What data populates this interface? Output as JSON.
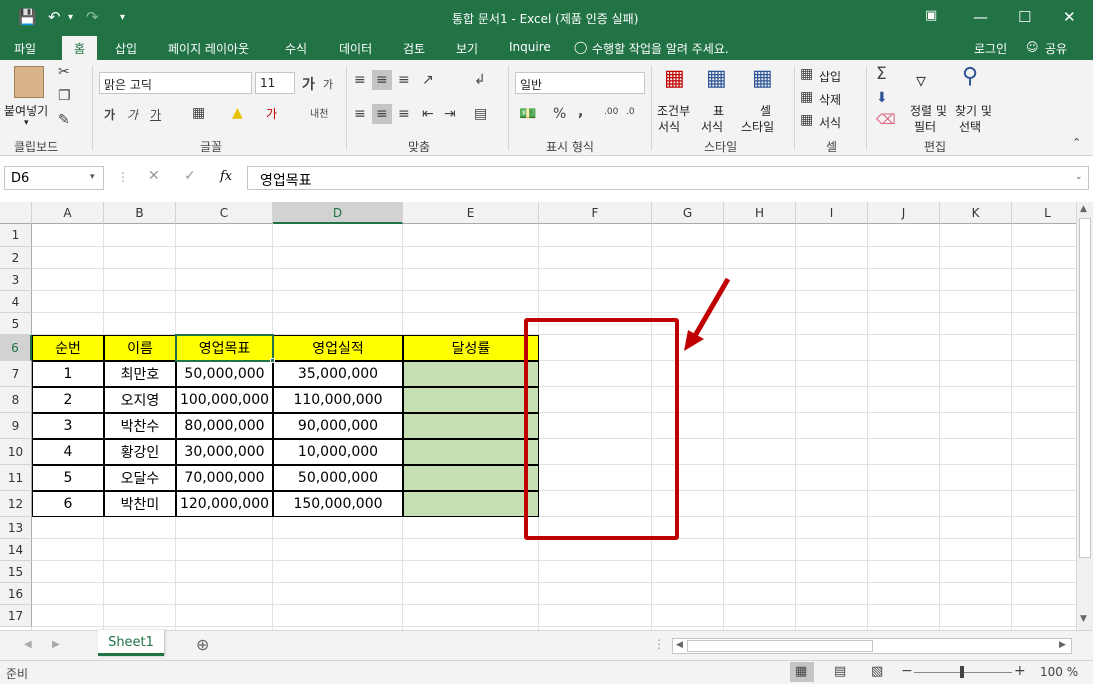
{
  "titlebar": {
    "title": "통합 문서1 - Excel (제품 인증 실패)",
    "save_icon": "save-icon",
    "undo_icon": "undo-icon",
    "redo_icon": "redo-icon"
  },
  "tabs": [
    "파일",
    "홈",
    "삽입",
    "페이지 레이아웃",
    "수식",
    "데이터",
    "검토",
    "보기",
    "Inquire"
  ],
  "tell_me": "수행할 작업을 알려 주세요.",
  "login": "로그인",
  "share": "공유",
  "ribbon": {
    "paste_label": "붙여넣기",
    "clipboard_label": "클립보드",
    "font_name": "맑은 고딕",
    "font_size": "11",
    "font_label": "글꼴",
    "align_label": "맞춤",
    "number_format": "일반",
    "number_label": "표시 형식",
    "cond_format_1": "조건부",
    "cond_format_2": "서식",
    "table_format_1": "표",
    "table_format_2": "서식",
    "cell_style_1": "셀",
    "cell_style_2": "스타일",
    "styles_label": "스타일",
    "insert_label": "삽입",
    "delete_label": "삭제",
    "format_label": "서식",
    "cells_label": "셀",
    "sort_1": "정렬 및",
    "sort_2": "필터",
    "find_1": "찾기 및",
    "find_2": "선택",
    "editing_label": "편집"
  },
  "formula_bar": {
    "name_box": "D6",
    "formula": "영업목표",
    "fx": "fx"
  },
  "columns": [
    "A",
    "B",
    "C",
    "D",
    "E",
    "F",
    "G",
    "H",
    "I",
    "J",
    "K",
    "L"
  ],
  "rows": [
    "1",
    "2",
    "3",
    "4",
    "5",
    "6",
    "7",
    "8",
    "9",
    "10",
    "11",
    "12",
    "13",
    "14",
    "15",
    "16",
    "17"
  ],
  "table": {
    "headers": [
      "순번",
      "이름",
      "영업목표",
      "영업실적",
      "달성률"
    ],
    "rows": [
      [
        "1",
        "최만호",
        "50,000,000",
        "35,000,000",
        ""
      ],
      [
        "2",
        "오지영",
        "100,000,000",
        "110,000,000",
        ""
      ],
      [
        "3",
        "박찬수",
        "80,000,000",
        "90,000,000",
        ""
      ],
      [
        "4",
        "황강인",
        "30,000,000",
        "10,000,000",
        ""
      ],
      [
        "5",
        "오달수",
        "70,000,000",
        "50,000,000",
        ""
      ],
      [
        "6",
        "박찬미",
        "120,000,000",
        "150,000,000",
        ""
      ]
    ]
  },
  "colors": {
    "excel_green": "#217346",
    "header_yellow": "#ffff00",
    "result_green": "#c6e0b4",
    "annotation_red": "#c00000"
  },
  "sheet_tab": "Sheet1",
  "status": {
    "ready": "준비",
    "zoom": "100 %"
  }
}
